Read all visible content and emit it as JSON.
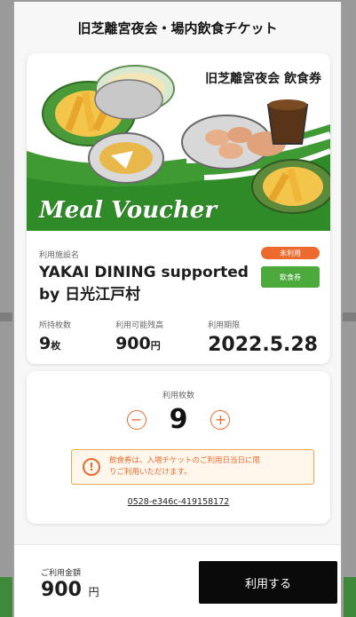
{
  "header": {
    "title": "旧芝離宮夜会・場内飲食チケット"
  },
  "ticket": {
    "banner_title": "旧芝離宮夜会 飲食券",
    "banner_text": "Meal Voucher",
    "facility_label": "利用施設名",
    "facility_name_line1": "YAKAI DINING supported",
    "facility_name_line2": "by 日光江戸村",
    "badge_status": "未利用",
    "badge_type": "飲食券",
    "stats": {
      "held_label": "所持枚数",
      "held_value": "9",
      "held_unit": "枚",
      "amount_label": "利用可能残高",
      "amount_value": "900",
      "amount_unit": "円",
      "deadline_label": "利用期限",
      "deadline_value": "2022.5.28"
    }
  },
  "quantity": {
    "label": "利用枚数",
    "value": "9",
    "minus": "−",
    "plus": "+",
    "notice_icon": "!",
    "notice_line1": "飲食券は、入場チケットのご利用日当日に限",
    "notice_line2": "りご利用いただけます。",
    "ticket_id": "0528-e346c-419158172"
  },
  "footer": {
    "total_label": "ご利用金額",
    "total_value": "900",
    "total_unit": "円",
    "use_button": "利用する"
  },
  "colors": {
    "accent_orange": "#ec6a2e",
    "accent_green": "#4caa3c",
    "button_black": "#0a0a0a"
  }
}
